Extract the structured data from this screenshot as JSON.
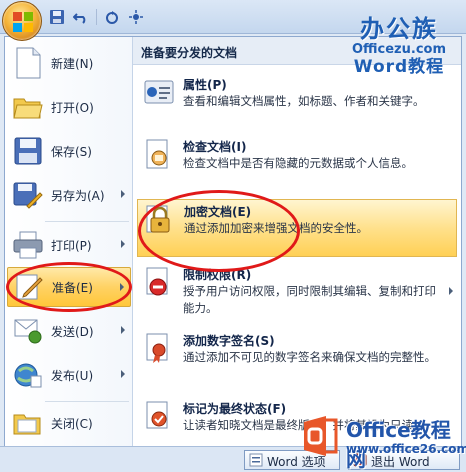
{
  "brand": {
    "title": "办公族",
    "url": "Officezu.com",
    "sub": "Word教程"
  },
  "left_menu": [
    {
      "id": "new",
      "label": "新建(N)",
      "icon": "new-document-icon",
      "has_arrow": false
    },
    {
      "id": "open",
      "label": "打开(O)",
      "icon": "open-folder-icon",
      "has_arrow": false
    },
    {
      "id": "save",
      "label": "保存(S)",
      "icon": "save-disk-icon",
      "has_arrow": false
    },
    {
      "id": "save-as",
      "label": "另存为(A)",
      "icon": "save-as-icon",
      "has_arrow": true
    },
    {
      "id": "print",
      "label": "打印(P)",
      "icon": "printer-icon",
      "has_arrow": true
    },
    {
      "id": "prepare",
      "label": "准备(E)",
      "icon": "prepare-pen-icon",
      "has_arrow": true,
      "active": true
    },
    {
      "id": "send",
      "label": "发送(D)",
      "icon": "send-icon",
      "has_arrow": true
    },
    {
      "id": "publish",
      "label": "发布(U)",
      "icon": "publish-icon",
      "has_arrow": true
    },
    {
      "id": "close",
      "label": "关闭(C)",
      "icon": "close-folder-icon",
      "has_arrow": false
    }
  ],
  "right_pane": {
    "header": "准备要分发的文档",
    "items": [
      {
        "id": "properties",
        "title": "属性(P)",
        "desc": "查看和编辑文档属性，如标题、作者和关键字。",
        "icon": "properties-icon",
        "has_arrow": false
      },
      {
        "id": "inspect",
        "title": "检查文档(I)",
        "desc": "检查文档中是否有隐藏的元数据或个人信息。",
        "icon": "inspect-document-icon",
        "has_arrow": false
      },
      {
        "id": "encrypt",
        "title": "加密文档(E)",
        "desc": "通过添加加密来增强文档的安全性。",
        "icon": "encrypt-lock-icon",
        "has_arrow": false,
        "active": true
      },
      {
        "id": "restrict",
        "title": "限制权限(R)",
        "desc": "授予用户访问权限，同时限制其编辑、复制和打印能力。",
        "icon": "restrict-permission-icon",
        "has_arrow": true
      },
      {
        "id": "signature",
        "title": "添加数字签名(S)",
        "desc": "通过添加不可见的数字签名来确保文档的完整性。",
        "icon": "digital-signature-icon",
        "has_arrow": false
      },
      {
        "id": "final",
        "title": "标记为最终状态(F)",
        "desc": "让读者知晓文档是最终版本，并将其设为只读。",
        "icon": "mark-final-icon",
        "has_arrow": false
      }
    ]
  },
  "bottom": {
    "options_label": "Word 选项",
    "exit_label": "退出 Word"
  },
  "watermark": {
    "title": "Office教程网",
    "url": "www.office26.com"
  }
}
